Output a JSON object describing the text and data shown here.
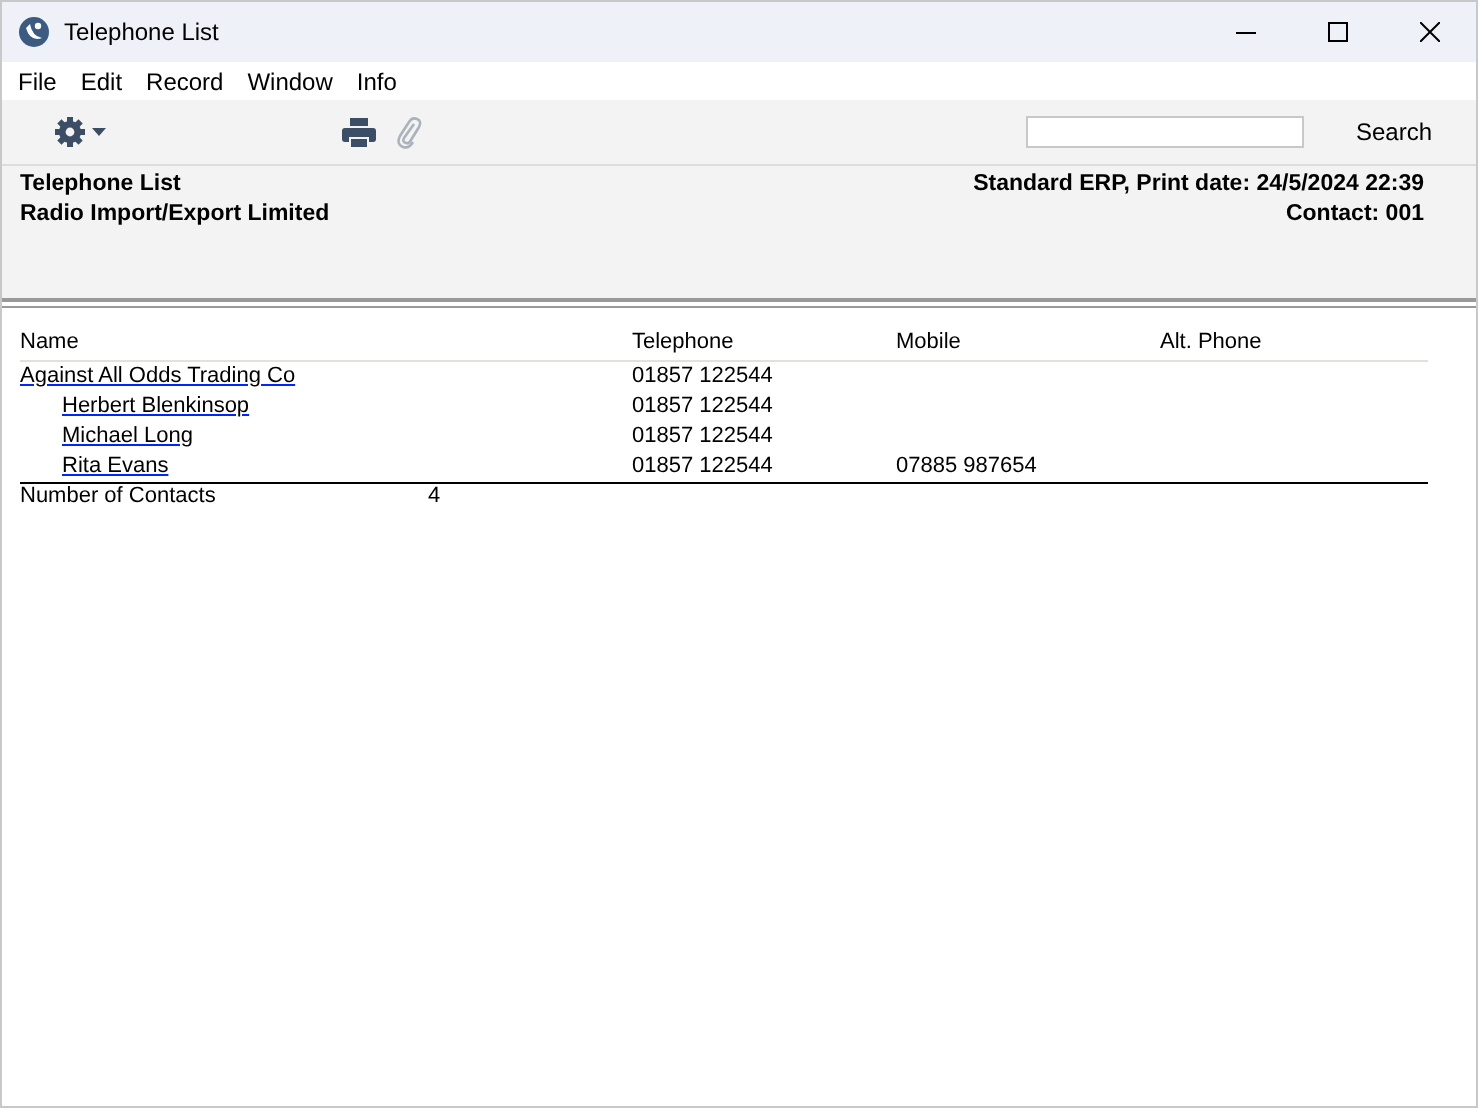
{
  "window": {
    "title": "Telephone List"
  },
  "menu": [
    "File",
    "Edit",
    "Record",
    "Window",
    "Info"
  ],
  "toolbar": {
    "search": {
      "button": "Search"
    }
  },
  "header": {
    "title": "Telephone List",
    "company": "Radio Import/Export Limited",
    "print_info": "Standard ERP, Print date: 24/5/2024 22:39",
    "contact": "Contact: 001"
  },
  "table": {
    "columns": [
      "Name",
      "Telephone",
      "Mobile",
      "Alt. Phone"
    ],
    "rows": [
      {
        "name": "Against All Odds Trading Co",
        "telephone": "01857 122544",
        "children": [
          {
            "name": "Herbert Blenkinsop",
            "telephone": "01857 122544"
          },
          {
            "name": "Michael Long",
            "telephone": "01857 122544"
          },
          {
            "name": "Rita Evans",
            "telephone": "01857 122544",
            "mobile": "07885 987654"
          }
        ]
      }
    ]
  },
  "footer": {
    "label": "Number of Contacts",
    "value": "4"
  }
}
